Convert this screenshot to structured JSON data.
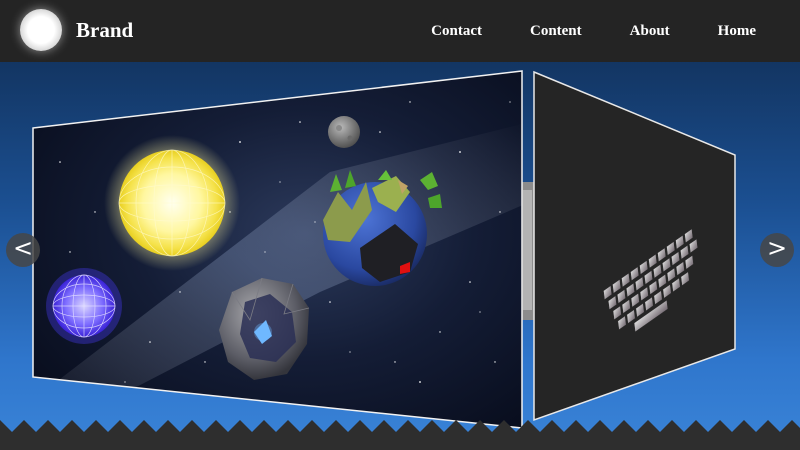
{
  "header": {
    "brand": "Brand",
    "logo_icon": "glowing-orb-icon",
    "nav": [
      {
        "label": "Contact"
      },
      {
        "label": "Content"
      },
      {
        "label": "About"
      },
      {
        "label": "Home"
      }
    ]
  },
  "slider": {
    "prev_label": "<",
    "next_label": ">",
    "slides": [
      {
        "image": "low-poly-space-scene"
      },
      {
        "image": "backlit-keyboard"
      }
    ]
  },
  "colors": {
    "header_bg": "#242424",
    "page_gradient_top": "#0f2a4e",
    "page_gradient_bottom": "#3a84d8",
    "zigzag": "#2e2e2e"
  }
}
